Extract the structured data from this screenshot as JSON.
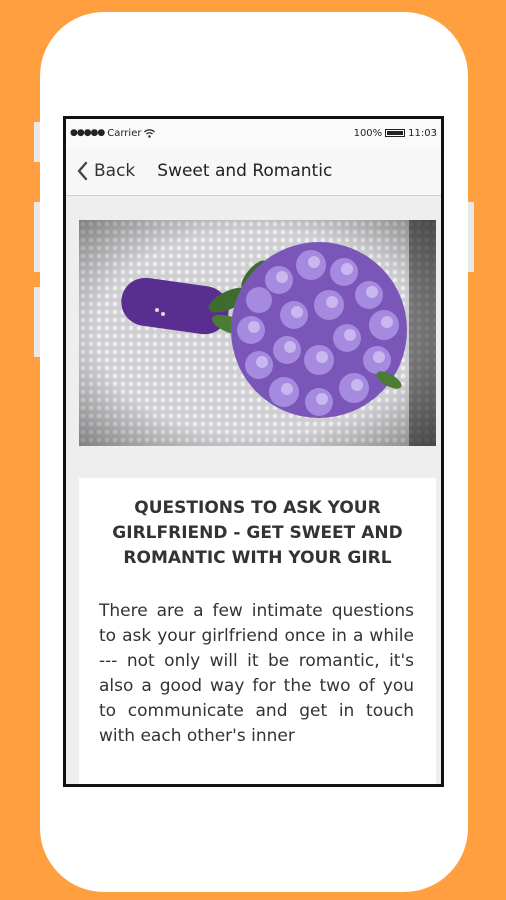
{
  "status_bar": {
    "carrier": "Carrier",
    "battery_percent": "100%",
    "time": "11:03"
  },
  "nav": {
    "back_label": "Back",
    "title": "Sweet and Romantic"
  },
  "article": {
    "title": "QUESTIONS TO ASK YOUR GIRLFRIEND - GET SWEET AND ROMANTIC WITH YOUR GIRL",
    "body": "There are a few intimate questions to ask your girlfriend once in a while --- not only will it be romantic, it's also a good way for the two of you to communicate and get in touch with each other's inner"
  },
  "colors": {
    "background": "#FF9F3F",
    "flower": "#8f6bd0",
    "stem": "#5a2d91"
  },
  "icons": {
    "back": "chevron-left-icon",
    "wifi": "wifi-icon",
    "battery": "battery-icon",
    "signal": "signal-dots-icon"
  }
}
